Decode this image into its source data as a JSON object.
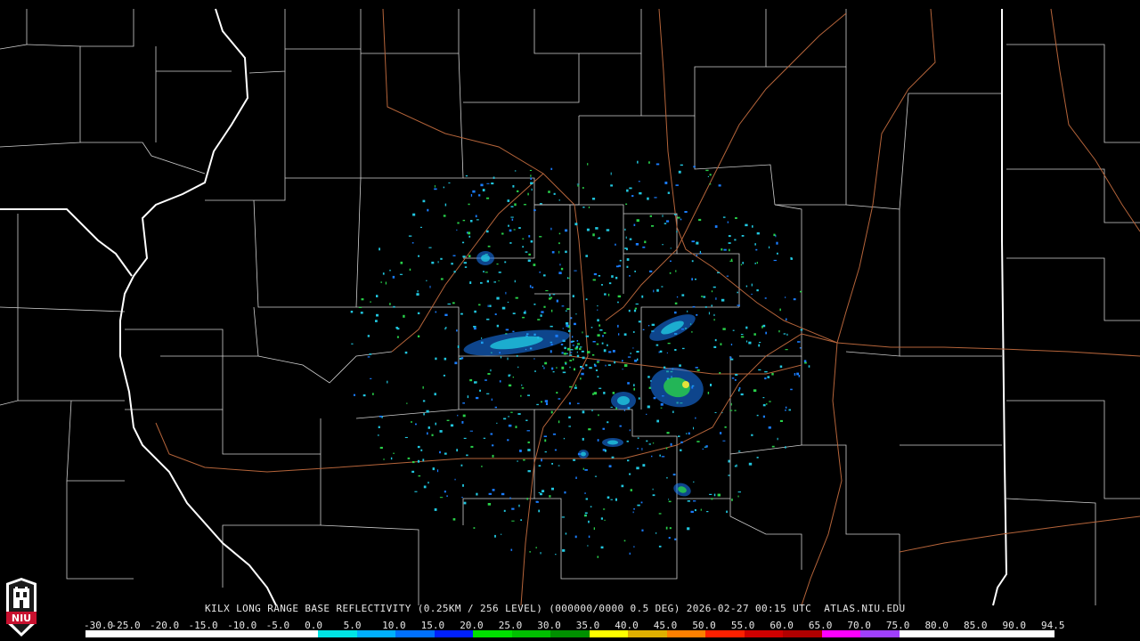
{
  "product": {
    "caption": "KILX LONG RANGE BASE REFLECTIVITY (0.25KM / 256 LEVEL) (000000/0000 0.5 DEG) 2026-02-27 00:15 UTC  ATLAS.NIU.EDU",
    "station": "KILX",
    "tilt_deg": 0.5,
    "valid_time": "2026-02-27 00:15 UTC",
    "source": "ATLAS.NIU.EDU"
  },
  "logo": {
    "text": "NIU",
    "color": "#c8102e"
  },
  "colorscale": {
    "labels": [
      "-30.0",
      "-25.0",
      "-20.0",
      "-15.0",
      "-10.0",
      "-5.0",
      "0.0",
      "5.0",
      "10.0",
      "15.0",
      "20.0",
      "25.0",
      "30.0",
      "35.0",
      "40.0",
      "45.0",
      "50.0",
      "55.0",
      "60.0",
      "65.0",
      "70.0",
      "75.0",
      "80.0",
      "85.0",
      "90.0",
      "94.5"
    ],
    "colors": [
      "#ffffff",
      "#ffffff",
      "#ffffff",
      "#ffffff",
      "#ffffff",
      "#ffffff",
      "#00e5e5",
      "#00b0ff",
      "#0070ff",
      "#0020ff",
      "#00e000",
      "#00c000",
      "#009000",
      "#ffff00",
      "#e0b000",
      "#ff8000",
      "#ff2000",
      "#d00000",
      "#b00000",
      "#ff00ff",
      "#a040ff",
      "#ffffff",
      "#ffffff",
      "#ffffff",
      "#ffffff"
    ]
  },
  "map_colors": {
    "county": "#d8d8d8",
    "state": "#ffffff",
    "highway": "#b5643a",
    "echo_light": "#21c7e0",
    "echo_blue": "#1a7dff",
    "echo_green": "#29d14a",
    "echo_yellow": "#e3e33a"
  }
}
